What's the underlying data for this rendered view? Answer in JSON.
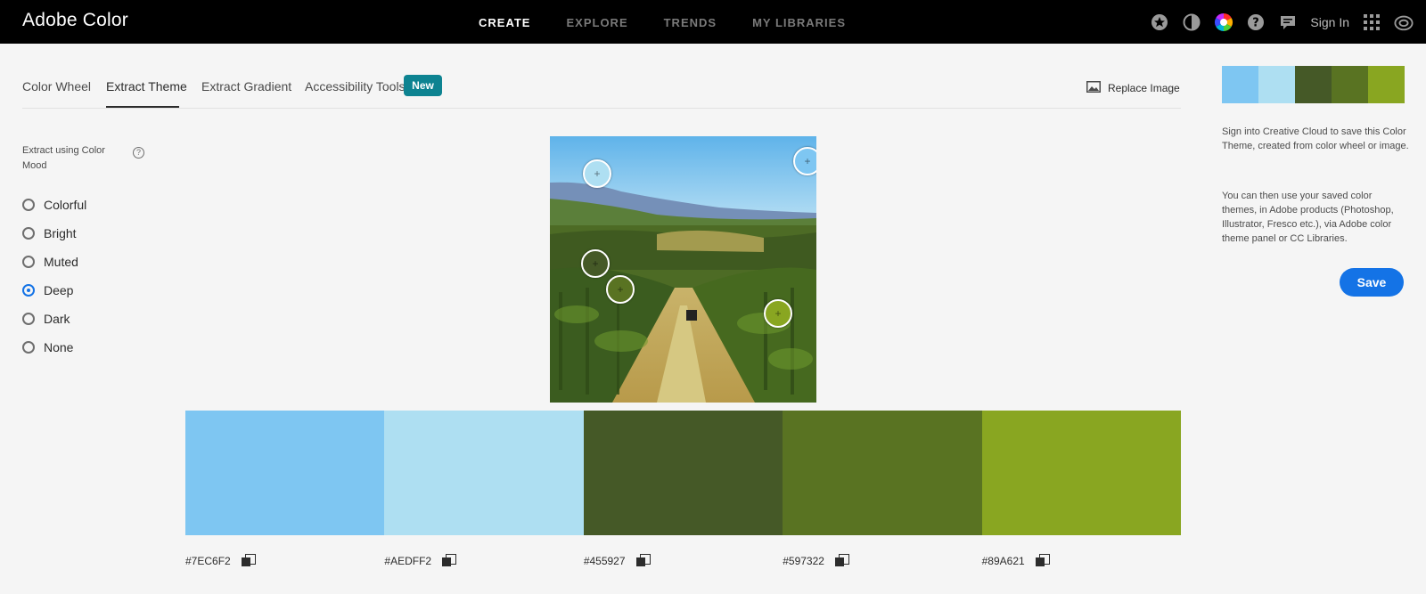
{
  "app": {
    "title": "Adobe Color"
  },
  "nav": {
    "items": [
      {
        "label": "CREATE",
        "active": true
      },
      {
        "label": "EXPLORE",
        "active": false
      },
      {
        "label": "TRENDS",
        "active": false
      },
      {
        "label": "MY LIBRARIES",
        "active": false
      }
    ],
    "sign_in": "Sign In",
    "icons": [
      "star-icon",
      "contrast-icon",
      "color-wheel-icon",
      "help-icon",
      "chat-icon",
      "apps-grid-icon",
      "creative-cloud-icon"
    ]
  },
  "tabs": {
    "items": [
      "Color Wheel",
      "Extract Theme",
      "Extract Gradient",
      "Accessibility Tools"
    ],
    "active": "Extract Theme",
    "new_badge": "New",
    "replace_image": "Replace Image"
  },
  "mood": {
    "label": "Extract using Color Mood",
    "help": "?",
    "options": [
      "Colorful",
      "Bright",
      "Muted",
      "Deep",
      "Dark",
      "None"
    ],
    "selected": "Deep"
  },
  "theme": {
    "colors": [
      "#7EC6F2",
      "#AEDFF2",
      "#455927",
      "#597322",
      "#89A621"
    ],
    "hex_labels": [
      "#7EC6F2",
      "#AEDFF2",
      "#455927",
      "#597322",
      "#89A621"
    ]
  },
  "side": {
    "info1": "Sign into Creative Cloud to save this Color Theme, created from color wheel or image.",
    "info2": "You can then use your saved color themes, in Adobe products (Photoshop, Illustrator, Fresco etc.), via Adobe color theme panel or CC Libraries.",
    "save_label": "Save"
  },
  "colors": {
    "accent": "#1473e6",
    "badge": "#0d8391",
    "topbar": "#000000"
  }
}
